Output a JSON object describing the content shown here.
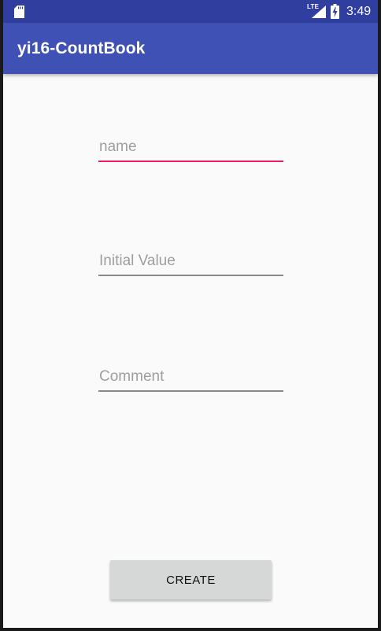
{
  "status_bar": {
    "network_type": "LTE",
    "time": "3:49",
    "color": "#303f9f"
  },
  "app_bar": {
    "title": "yi16-CountBook",
    "color": "#3f51b5"
  },
  "form": {
    "name": {
      "value": "",
      "placeholder": "name",
      "focused": true
    },
    "initial_value": {
      "value": "",
      "placeholder": "Initial Value"
    },
    "comment": {
      "value": "",
      "placeholder": "Comment"
    },
    "create_label": "CREATE",
    "accent_color": "#e91e63"
  },
  "icons": {
    "sd_card": "sd-card-icon",
    "signal": "signal-icon",
    "battery": "battery-charging-icon"
  }
}
